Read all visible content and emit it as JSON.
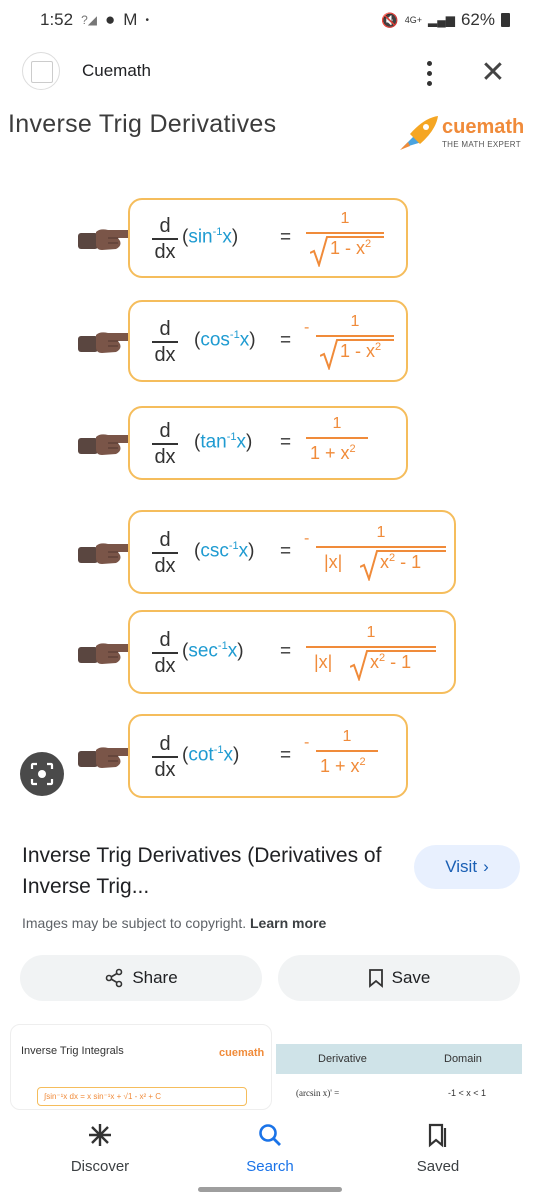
{
  "status_bar": {
    "time": "1:52",
    "battery": "62%",
    "network": "4G+"
  },
  "browser": {
    "site_name": "Cuemath"
  },
  "image": {
    "title": "Inverse Trig Derivatives",
    "logo_text": "cuemath",
    "logo_sub": "THE MATH EXPERT",
    "formulas": [
      {
        "dx_num": "d",
        "dx_den": "dx",
        "fn": "sin",
        "neg": "",
        "num": "1",
        "den": "1 - x²",
        "has_abs": false,
        "has_sqrt": true
      },
      {
        "dx_num": "d",
        "dx_den": "dx",
        "fn": "cos",
        "neg": "-",
        "num": "1",
        "den": "1 - x²",
        "has_abs": false,
        "has_sqrt": true
      },
      {
        "dx_num": "d",
        "dx_den": "dx",
        "fn": "tan",
        "neg": "",
        "num": "1",
        "den": "1 + x²",
        "has_abs": false,
        "has_sqrt": false
      },
      {
        "dx_num": "d",
        "dx_den": "dx",
        "fn": "csc",
        "neg": "-",
        "num": "1",
        "den": "x² - 1",
        "has_abs": true,
        "has_sqrt": true
      },
      {
        "dx_num": "d",
        "dx_den": "dx",
        "fn": "sec",
        "neg": "",
        "num": "1",
        "den": "x² - 1",
        "has_abs": true,
        "has_sqrt": true
      },
      {
        "dx_num": "d",
        "dx_den": "dx",
        "fn": "cot",
        "neg": "-",
        "num": "1",
        "den": "1 + x²",
        "has_abs": false,
        "has_sqrt": false
      }
    ],
    "fn_sup": "-1",
    "fn_var": "x",
    "abs_label": "|x|",
    "eq": "="
  },
  "result": {
    "title": "Inverse Trig Derivatives (Derivatives of Inverse Trig...",
    "visit_label": "Visit",
    "copyright": "Images may be subject to copyright.",
    "learn_more": "Learn more",
    "share_label": "Share",
    "save_label": "Save"
  },
  "related": {
    "card1_title": "Inverse Trig Integrals",
    "card1_logo": "cuemath",
    "card1_formula": "∫sin⁻¹x dx = x sin⁻¹x + √1 - x² + C",
    "card2_col1": "Derivative",
    "card2_col2": "Domain",
    "card2_row_formula": "(arcsin x)' =",
    "card2_row_domain": "-1 < x < 1"
  },
  "bottom_nav": {
    "items": [
      {
        "label": "Discover",
        "icon": "asterisk-icon"
      },
      {
        "label": "Search",
        "icon": "search-icon"
      },
      {
        "label": "Saved",
        "icon": "bookmark-icon"
      }
    ]
  },
  "colors": {
    "accent": "#1a73e8",
    "formula_border": "#f5bd5c",
    "fn_blue": "#1f9bd1",
    "rhs_orange": "#f08b3a"
  }
}
